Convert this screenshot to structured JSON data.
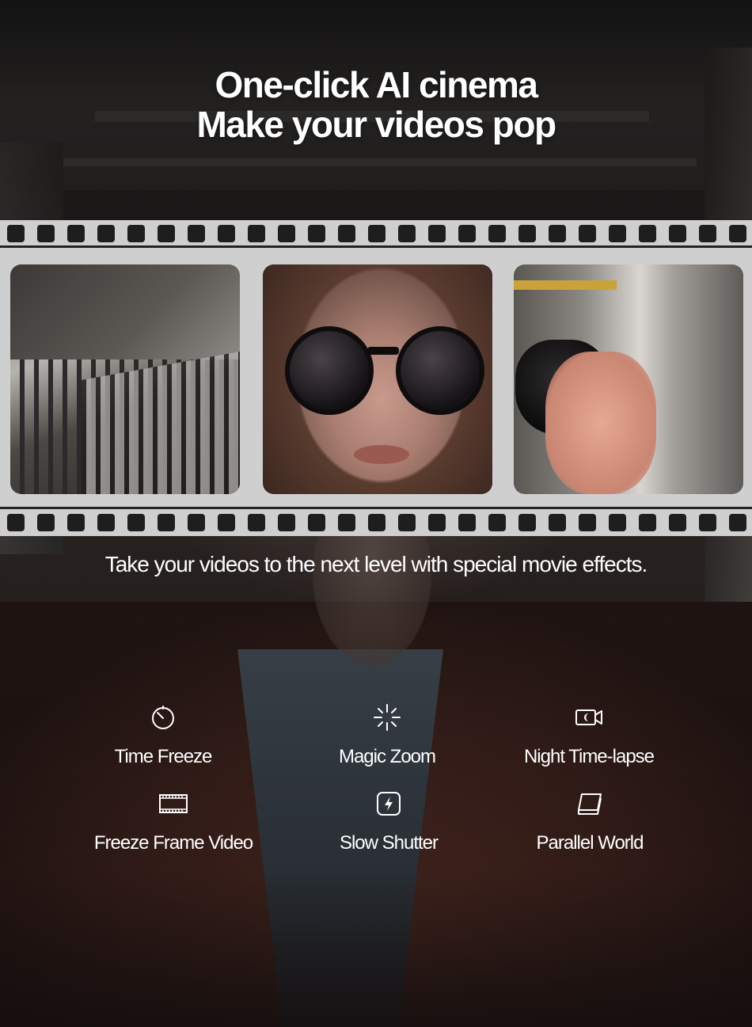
{
  "headline": {
    "line1": "One-click AI cinema",
    "line2": "Make your videos pop"
  },
  "filmstrip": {
    "frames": [
      "staircase-frame",
      "portrait-sunglasses-frame",
      "hand-sunglasses-frame"
    ]
  },
  "tagline": "Take your videos to the next level with special movie effects.",
  "features": [
    {
      "label": "Time Freeze",
      "icon": "timer-icon"
    },
    {
      "label": "Magic Zoom",
      "icon": "sparkle-burst-icon"
    },
    {
      "label": "Night Time-lapse",
      "icon": "video-camera-icon"
    },
    {
      "label": "Freeze Frame Video",
      "icon": "film-strip-icon"
    },
    {
      "label": "Slow Shutter",
      "icon": "flash-bolt-icon"
    },
    {
      "label": "Parallel World",
      "icon": "stacked-layers-icon"
    }
  ],
  "colors": {
    "text": "#ffffff",
    "film_strip": "#cfcfcf",
    "sprocket": "#1e1e1e"
  }
}
